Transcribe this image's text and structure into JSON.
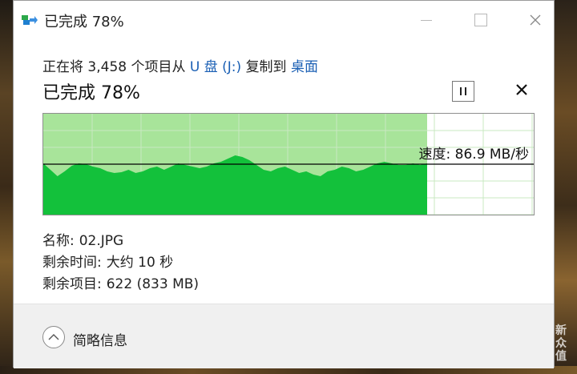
{
  "window": {
    "title": "已完成 78%",
    "icon": "copy-arrow-icon"
  },
  "operation": {
    "prefix": "正在将 3,458 个项目从",
    "source": "U 盘 (J:)",
    "middle": "复制到",
    "destination": "桌面",
    "status": "已完成 78%",
    "progress_percent": 78
  },
  "controls": {
    "pause_icon": "pause-icon",
    "cancel_icon": "close-icon"
  },
  "graph": {
    "speed_label": "速度: 86.9 MB/秒",
    "colors": {
      "progress_bg": "#a8e49a",
      "throughput": "#13c13b",
      "speed_line": "#000000"
    }
  },
  "details": {
    "name_label": "名称:",
    "name_value": "02.JPG",
    "time_label": "剩余时间:",
    "time_value": "大约 10 秒",
    "items_label": "剩余项目:",
    "items_value": "622 (833 MB)"
  },
  "footer": {
    "toggle_label": "简略信息"
  },
  "watermark": {
    "line1": "新",
    "line2": "众",
    "line3": "值"
  }
}
